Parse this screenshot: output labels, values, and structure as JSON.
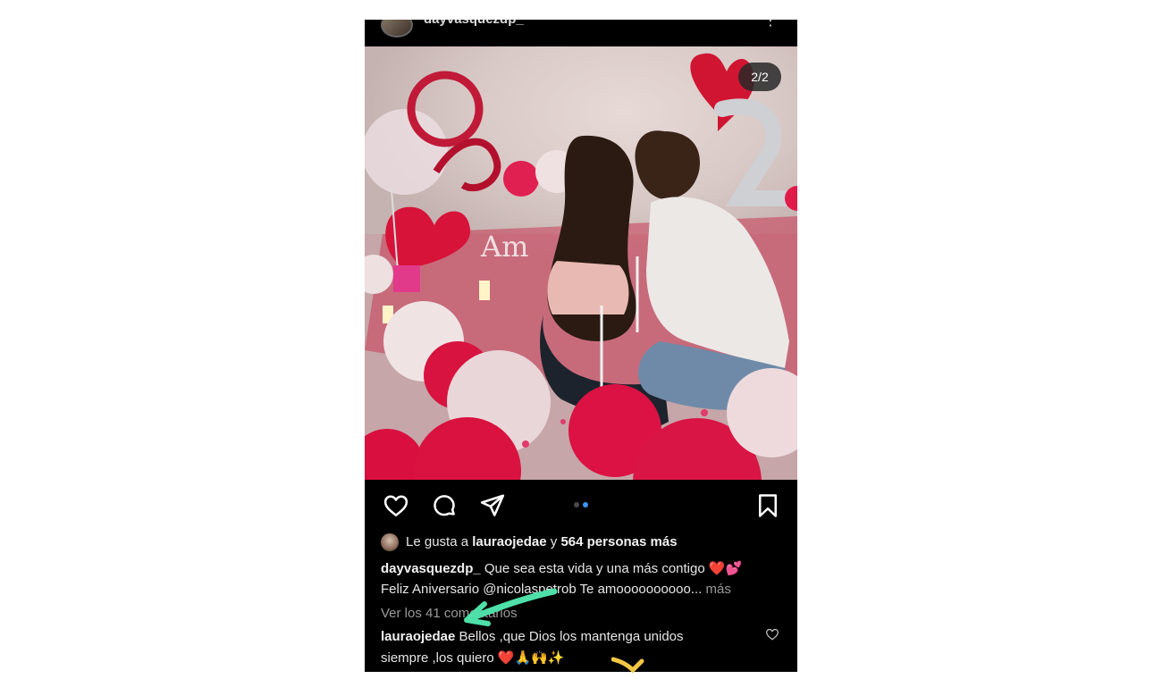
{
  "post": {
    "author": "dayvasquezdp_",
    "image_counter": "2/2",
    "likes": {
      "prefix": "Le gusta a ",
      "user": "lauraojedae",
      "conj": " y ",
      "others": "564 personas más"
    },
    "caption": {
      "author": "dayvasquezdp_",
      "line1": " Que sea esta vida y una más contigo ❤️💕",
      "line2": "Feliz Aniversario @nicolaspetrob Te amoooooooooo...",
      "more": " más"
    },
    "view_comments": "Ver los 41 comentarios",
    "comment": {
      "author": "lauraojedae",
      "line1": " Bellos ,que Dios los mantenga unidos",
      "line2": "siempre ,los quiero ❤️🙏🙌✨"
    }
  },
  "icons": {
    "like": "heart-icon",
    "comment": "comment-icon",
    "share": "send-icon",
    "save": "bookmark-icon",
    "more": "more-icon",
    "comment_like": "heart-icon"
  },
  "colors": {
    "background": "#000000",
    "text": "#e6e6e6",
    "muted": "#9a9a9a",
    "dot_active": "#3897f0",
    "dot_inactive": "#4a4a4a",
    "annotation_arrow": "#4ee0a8",
    "balloon_red": "#e0103f",
    "balloon_pink": "#f3c3cf"
  }
}
